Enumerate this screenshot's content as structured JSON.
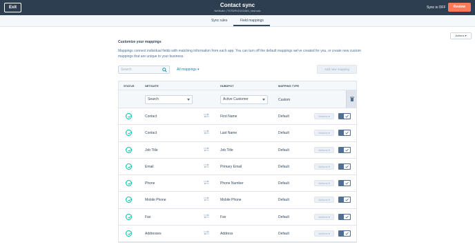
{
  "topbar": {
    "exit_label": "Exit",
    "title": "Contact sync",
    "subtitle": "NetSuite | TSTDRV2101604 | test.sdo",
    "sync_status": "Sync is OFF",
    "review_label": "Review"
  },
  "tabs": [
    {
      "label": "Sync rules",
      "active": false
    },
    {
      "label": "Field mappings",
      "active": true
    }
  ],
  "actions_top_label": "Actions ▾",
  "main": {
    "heading": "Customize your mappings",
    "description": "Mappings connect individual fields with matching information from each app. You can turn off the default mappings we've created for you, or create new custom mappings that are unique to your business.",
    "search_placeholder": "Search",
    "filter_label": "All mappings ▾",
    "add_label": "Add new mapping"
  },
  "table": {
    "headers": {
      "status": "STATUS",
      "netsuite": "NETSUITE",
      "hubspot": "HUBSPOT",
      "mapping_type": "MAPPING TYPE"
    },
    "filter_row": {
      "netsuite_value": "Search",
      "hubspot_value": "Active Customer",
      "mapping_type": "Custom"
    },
    "row_action_label": "Actions ▾",
    "rows": [
      {
        "netsuite": "Contact",
        "hubspot": "First Name",
        "type": "Default"
      },
      {
        "netsuite": "Contact",
        "hubspot": "Last Name",
        "type": "Default"
      },
      {
        "netsuite": "Job Title",
        "hubspot": "Job Title",
        "type": "Default"
      },
      {
        "netsuite": "Email",
        "hubspot": "Primary Email",
        "type": "Default"
      },
      {
        "netsuite": "Phone",
        "hubspot": "Phone Number",
        "type": "Default"
      },
      {
        "netsuite": "Mobile Phone",
        "hubspot": "Mobile Phone",
        "type": "Default"
      },
      {
        "netsuite": "Fax",
        "hubspot": "Fax",
        "type": "Default"
      },
      {
        "netsuite": "Addresses",
        "hubspot": "Address",
        "type": "Default"
      }
    ]
  },
  "colors": {
    "topbar": "#2d3e50",
    "review": "#ff7a59",
    "check": "#00bda5",
    "link": "#0091ae"
  }
}
